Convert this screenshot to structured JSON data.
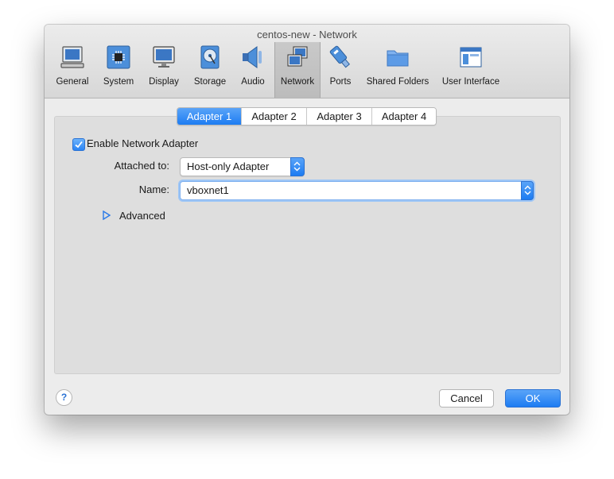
{
  "window": {
    "title": "centos-new - Network"
  },
  "toolbar": {
    "items": [
      {
        "label": "General",
        "icon": "general-icon"
      },
      {
        "label": "System",
        "icon": "system-icon"
      },
      {
        "label": "Display",
        "icon": "display-icon"
      },
      {
        "label": "Storage",
        "icon": "storage-icon"
      },
      {
        "label": "Audio",
        "icon": "audio-icon"
      },
      {
        "label": "Network",
        "icon": "network-icon",
        "selected": true
      },
      {
        "label": "Ports",
        "icon": "ports-icon"
      },
      {
        "label": "Shared Folders",
        "icon": "shared-folders-icon"
      },
      {
        "label": "User Interface",
        "icon": "user-interface-icon"
      }
    ]
  },
  "tabs": [
    {
      "label": "Adapter 1",
      "active": true
    },
    {
      "label": "Adapter 2"
    },
    {
      "label": "Adapter 3"
    },
    {
      "label": "Adapter 4"
    }
  ],
  "adapter": {
    "enable_label": "Enable Network Adapter",
    "enabled": true,
    "attached_label": "Attached to:",
    "attached_value": "Host-only Adapter",
    "name_label": "Name:",
    "name_value": "vboxnet1",
    "advanced_label": "Advanced"
  },
  "footer": {
    "help_label": "?",
    "cancel_label": "Cancel",
    "ok_label": "OK"
  },
  "colors": {
    "accent": "#1d7cf2",
    "window_bg": "#ececec",
    "panel_bg": "#dedede"
  }
}
